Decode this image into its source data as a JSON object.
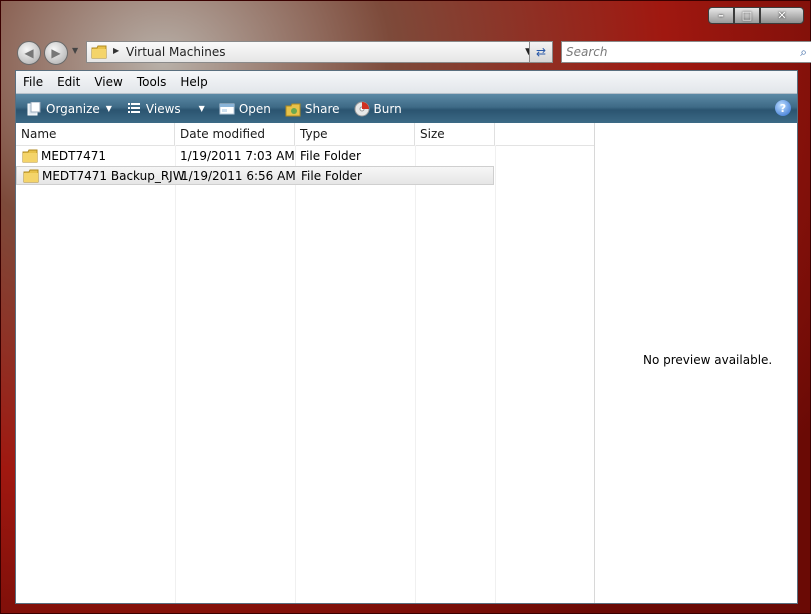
{
  "window": {
    "accent": "#3e6a86"
  },
  "address": {
    "path": "Virtual Machines"
  },
  "search": {
    "placeholder": "Search"
  },
  "menu": [
    "File",
    "Edit",
    "View",
    "Tools",
    "Help"
  ],
  "toolbar": {
    "organize": "Organize",
    "views": "Views",
    "open": "Open",
    "share": "Share",
    "burn": "Burn"
  },
  "columns": {
    "name": "Name",
    "date": "Date modified",
    "type": "Type",
    "size": "Size"
  },
  "files": [
    {
      "name": "MEDT7471",
      "date": "1/19/2011 7:03 AM",
      "type": "File Folder",
      "size": ""
    },
    {
      "name": "MEDT7471 Backup_RJW",
      "date": "1/19/2011 6:56 AM",
      "type": "File Folder",
      "size": ""
    }
  ],
  "preview": {
    "message": "No preview available."
  }
}
